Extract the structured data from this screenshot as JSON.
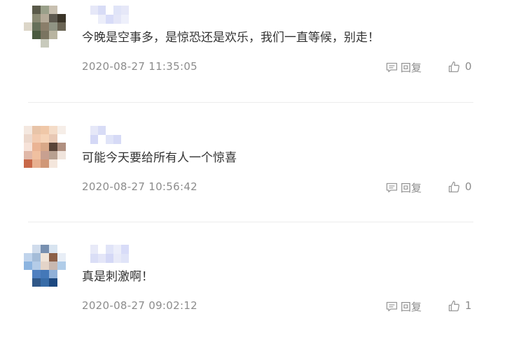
{
  "comments": [
    {
      "content": "今晚是空事多，是惊恐还是欢乐，我们一直等候，别走！",
      "time": "2020-08-27 11:35:05",
      "reply_label": "回复",
      "likes": "0",
      "avatar_icon": "pixelated-avatar-image",
      "avatar_colors": [
        "#ffffff",
        "#5a5a4a",
        "#9aa08a",
        "#c8c0b0",
        "#ffffff",
        "#ffffff",
        "#8a8a74",
        "#b4aa98",
        "#5e5a50",
        "#3a3428",
        "#dcd6c8",
        "#66705a",
        "#8a7e6a",
        "#909484",
        "#6a6454",
        "#ffffff",
        "#4a5a40",
        "#7a7460",
        "#b8b4a0",
        "#ffffff",
        "#ffffff",
        "#ffffff",
        "#c8cabc",
        "#ffffff",
        "#ffffff"
      ],
      "username_colors": [
        "#ffffff",
        "#e6e8f8",
        "#d8dcf6",
        "#ffffff",
        "#e0e4f8",
        "#e6e8f8",
        "#ffffff",
        "#ffffff",
        "#ffffff",
        "#ffffff",
        "#eceefa",
        "#d8dcf8",
        "#e4e6f8",
        "#eef0fb",
        "#ffffff",
        "#ffffff"
      ]
    },
    {
      "content": "可能今天要给所有人一个惊喜",
      "time": "2020-08-27 10:56:42",
      "reply_label": "回复",
      "likes": "0",
      "avatar_icon": "pixelated-avatar-image",
      "avatar_colors": [
        "#f4e8e0",
        "#e8c4a8",
        "#f0c8a8",
        "#f4dcc8",
        "#f6eee8",
        "#ecd8cc",
        "#f2cbb0",
        "#f6d4b8",
        "#e8c8b4",
        "#ffffff",
        "#f6e2d8",
        "#eab494",
        "#d8a888",
        "#5a4438",
        "#b09080",
        "#e0b8a8",
        "#f0c0a0",
        "#c8a090",
        "#b8a090",
        "#f0e4dc",
        "#c86848",
        "#e8b090",
        "#d09878",
        "#f4e6dc",
        "#ffffff"
      ],
      "username_colors": [
        "#ffffff",
        "#e6e8f8",
        "#d8dcf6",
        "#ffffff",
        "#ffffff",
        "#ffffff",
        "#ffffff",
        "#ffffff",
        "#ffffff",
        "#d4d8f6",
        "#ffffff",
        "#e0e4f8",
        "#d6daf6",
        "#ffffff",
        "#ffffff",
        "#ffffff"
      ]
    },
    {
      "content": "真是刺激啊！",
      "time": "2020-08-27 09:02:12",
      "reply_label": "回复",
      "likes": "1",
      "avatar_icon": "pixelated-avatar-image",
      "avatar_colors": [
        "#ffffff",
        "#d0dcec",
        "#7890b0",
        "#d8e4f0",
        "#ffffff",
        "#c0d4ec",
        "#a4bcd8",
        "#f0e4d8",
        "#8c6048",
        "#e8eef6",
        "#8cb4e0",
        "#b4cce8",
        "#e4d4c8",
        "#c8b8b0",
        "#b0cce8",
        "#ffffff",
        "#5080c0",
        "#4478b8",
        "#90b0d8",
        "#ffffff",
        "#ffffff",
        "#305888",
        "#386ca8",
        "#1c4880",
        "#ffffff"
      ],
      "username_colors": [
        "#ffffff",
        "#e8eaf8",
        "#ffffff",
        "#e0e4f8",
        "#eceefa",
        "#d8dcf8",
        "#ffffff",
        "#ffffff",
        "#ffffff",
        "#dadef6",
        "#e4e6f8",
        "#d4d8f6",
        "#e8eaf8",
        "#e0e4f8",
        "#ffffff",
        "#ffffff"
      ]
    }
  ]
}
